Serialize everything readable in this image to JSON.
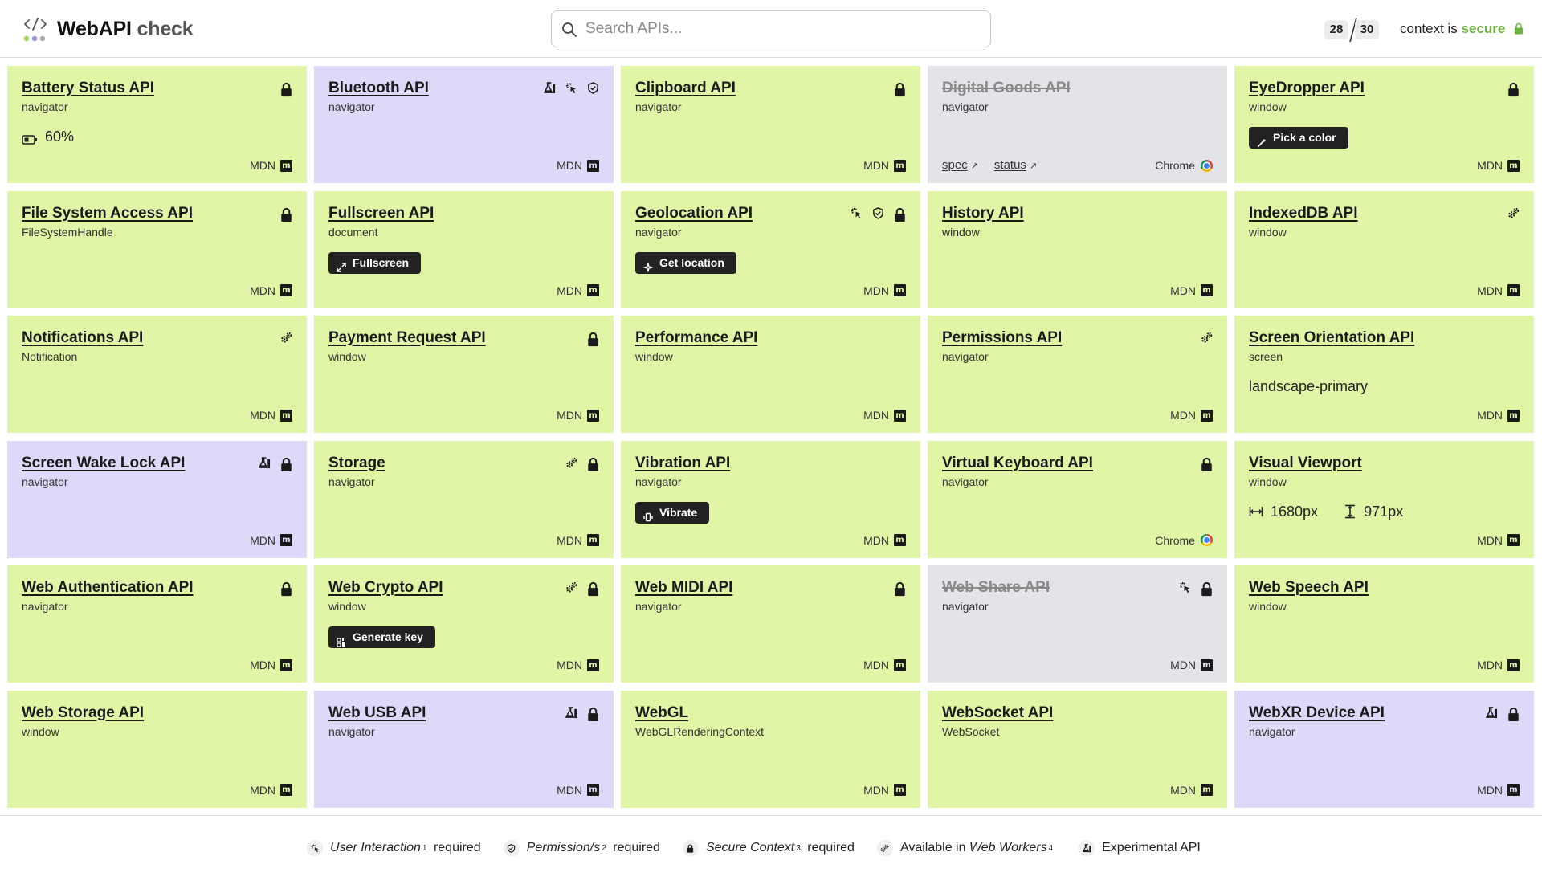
{
  "header": {
    "brand_main": "WebAPI",
    "brand_sub": "check",
    "search_placeholder": "Search APIs...",
    "count_supported": "28",
    "count_total": "30",
    "context_prefix": "context is",
    "context_state": "secure"
  },
  "colors": {
    "supported": "#e0f5a5",
    "experimental": "#ddd9f9",
    "unsupported": "#e3e3e8",
    "secure": "#6db33f"
  },
  "cards": [
    {
      "title": "Battery Status API",
      "sub": "navigator",
      "status": "supported",
      "icons": [
        "lock-icon"
      ],
      "value": "60%",
      "value_icon": "battery-icon",
      "footer": "MDN"
    },
    {
      "title": "Bluetooth API",
      "sub": "navigator",
      "status": "experimental",
      "icons": [
        "flask-icon",
        "click-icon",
        "shield-icon"
      ],
      "footer": "MDN"
    },
    {
      "title": "Clipboard API",
      "sub": "navigator",
      "status": "supported",
      "icons": [
        "lock-icon"
      ],
      "footer": "MDN"
    },
    {
      "title": "Digital Goods API",
      "sub": "navigator",
      "status": "unsupported",
      "icons": [],
      "links": [
        "spec",
        "status"
      ],
      "footer": "Chrome"
    },
    {
      "title": "EyeDropper API",
      "sub": "window",
      "status": "supported",
      "icons": [
        "lock-icon"
      ],
      "button": "Pick a color",
      "button_icon": "eyedropper-icon",
      "footer": "MDN"
    },
    {
      "title": "File System Access API",
      "sub": "FileSystemHandle",
      "status": "supported",
      "icons": [
        "lock-icon"
      ],
      "footer": "MDN"
    },
    {
      "title": "Fullscreen API",
      "sub": "document",
      "status": "supported",
      "icons": [],
      "button": "Fullscreen",
      "button_icon": "expand-icon",
      "footer": "MDN"
    },
    {
      "title": "Geolocation API",
      "sub": "navigator",
      "status": "supported",
      "icons": [
        "click-icon",
        "shield-icon",
        "lock-icon"
      ],
      "button": "Get location",
      "button_icon": "crosshair-icon",
      "footer": "MDN"
    },
    {
      "title": "History API",
      "sub": "window",
      "status": "supported",
      "icons": [],
      "footer": "MDN"
    },
    {
      "title": "IndexedDB API",
      "sub": "window",
      "status": "supported",
      "icons": [
        "gears-icon"
      ],
      "footer": "MDN"
    },
    {
      "title": "Notifications API",
      "sub": "Notification",
      "status": "supported",
      "icons": [
        "gears-icon"
      ],
      "footer": "MDN"
    },
    {
      "title": "Payment Request API",
      "sub": "window",
      "status": "supported",
      "icons": [
        "lock-icon"
      ],
      "footer": "MDN"
    },
    {
      "title": "Performance API",
      "sub": "window",
      "status": "supported",
      "icons": [],
      "footer": "MDN"
    },
    {
      "title": "Permissions API",
      "sub": "navigator",
      "status": "supported",
      "icons": [
        "gears-icon"
      ],
      "footer": "MDN"
    },
    {
      "title": "Screen Orientation API",
      "sub": "screen",
      "status": "supported",
      "icons": [],
      "value": "landscape-primary",
      "footer": "MDN"
    },
    {
      "title": "Screen Wake Lock API",
      "sub": "navigator",
      "status": "experimental",
      "icons": [
        "flask-icon",
        "lock-icon"
      ],
      "footer": "MDN"
    },
    {
      "title": "Storage",
      "sub": "navigator",
      "status": "supported",
      "icons": [
        "gears-icon",
        "lock-icon"
      ],
      "footer": "MDN"
    },
    {
      "title": "Vibration API",
      "sub": "navigator",
      "status": "supported",
      "icons": [],
      "button": "Vibrate",
      "button_icon": "vibrate-icon",
      "footer": "MDN"
    },
    {
      "title": "Virtual Keyboard API",
      "sub": "navigator",
      "status": "supported",
      "icons": [
        "lock-icon"
      ],
      "footer": "Chrome"
    },
    {
      "title": "Visual Viewport",
      "sub": "window",
      "status": "supported",
      "icons": [],
      "value_width": "1680px",
      "value_height": "971px",
      "footer": "MDN"
    },
    {
      "title": "Web Authentication API",
      "sub": "navigator",
      "status": "supported",
      "icons": [
        "lock-icon"
      ],
      "footer": "MDN"
    },
    {
      "title": "Web Crypto API",
      "sub": "window",
      "status": "supported",
      "icons": [
        "gears-icon",
        "lock-icon"
      ],
      "button": "Generate key",
      "button_icon": "key-icon",
      "footer": "MDN"
    },
    {
      "title": "Web MIDI API",
      "sub": "navigator",
      "status": "supported",
      "icons": [
        "lock-icon"
      ],
      "footer": "MDN"
    },
    {
      "title": "Web Share API",
      "sub": "navigator",
      "status": "unsupported",
      "icons": [
        "click-icon",
        "lock-icon"
      ],
      "footer": "MDN"
    },
    {
      "title": "Web Speech API",
      "sub": "window",
      "status": "supported",
      "icons": [],
      "footer": "MDN"
    },
    {
      "title": "Web Storage API",
      "sub": "window",
      "status": "supported",
      "icons": [],
      "footer": "MDN"
    },
    {
      "title": "Web USB API",
      "sub": "navigator",
      "status": "experimental",
      "icons": [
        "flask-icon",
        "lock-icon"
      ],
      "footer": "MDN"
    },
    {
      "title": "WebGL",
      "sub": "WebGLRenderingContext",
      "status": "supported",
      "icons": [],
      "footer": "MDN"
    },
    {
      "title": "WebSocket API",
      "sub": "WebSocket",
      "status": "supported",
      "icons": [],
      "footer": "MDN"
    },
    {
      "title": "WebXR Device API",
      "sub": "navigator",
      "status": "experimental",
      "icons": [
        "flask-icon",
        "lock-icon"
      ],
      "footer": "MDN"
    }
  ],
  "legend": [
    {
      "icon": "click-icon",
      "em": "User Interaction",
      "sup": "1",
      "rest": "required"
    },
    {
      "icon": "shield-icon",
      "em": "Permission/s",
      "sup": "2",
      "rest": "required"
    },
    {
      "icon": "lock-icon",
      "em": "Secure Context",
      "sup": "3",
      "rest": "required"
    },
    {
      "icon": "gears-icon",
      "pre": "Available in",
      "em": "Web Workers",
      "sup": "4",
      "rest": ""
    },
    {
      "icon": "flask-icon",
      "pre": "Experimental API",
      "em": "",
      "sup": "",
      "rest": ""
    }
  ]
}
